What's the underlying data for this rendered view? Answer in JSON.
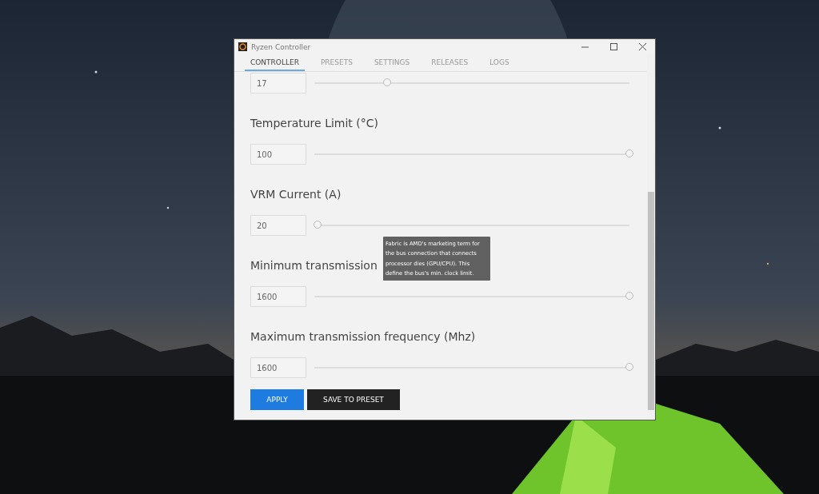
{
  "window": {
    "title": "Ryzen Controller"
  },
  "tabs": [
    {
      "label": "CONTROLLER",
      "selected": true
    },
    {
      "label": "PRESETS",
      "selected": false
    },
    {
      "label": "SETTINGS",
      "selected": false
    },
    {
      "label": "RELEASES",
      "selected": false
    },
    {
      "label": "LOGS",
      "selected": false
    }
  ],
  "settings": [
    {
      "value": "17",
      "level": 0.23
    },
    {
      "label": "Temperature Limit (°C)",
      "value": "100",
      "level": 1
    },
    {
      "label": "VRM Current (A)",
      "value": "20",
      "level": 0.01
    },
    {
      "label": "Minimum transmission",
      "value": "1600",
      "level": 1
    },
    {
      "label": "Maximum transmission frequency (Mhz)",
      "value": "1600",
      "level": 1
    }
  ],
  "tooltip": "Fabric is AMD's marketing term for the bus connection that connects processor dies (GPU/CPU). This define the bus's min. clock limit.",
  "buttons": [
    {
      "label": "APPLY",
      "kind": "primary"
    },
    {
      "label": "SAVE TO PRESET",
      "kind": "dark"
    }
  ]
}
